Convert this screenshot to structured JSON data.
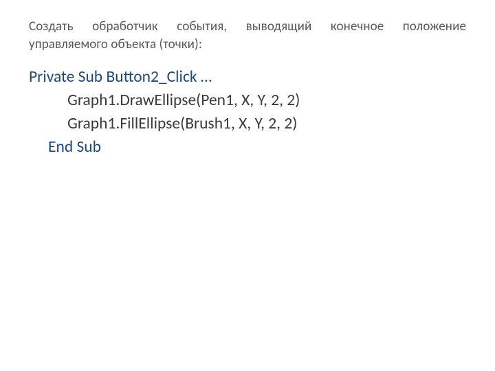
{
  "header": {
    "text": "Создать обработчик события, выводящий конечное положение управляемого объекта (точки):"
  },
  "code": {
    "line1": "Private Sub Button2_Click …",
    "line2": "Graph1.DrawEllipse(Pen1, X, Y, 2, 2)",
    "line3": "Graph1.FillEllipse(Brush1, X, Y, 2, 2)",
    "line4": "End Sub"
  }
}
